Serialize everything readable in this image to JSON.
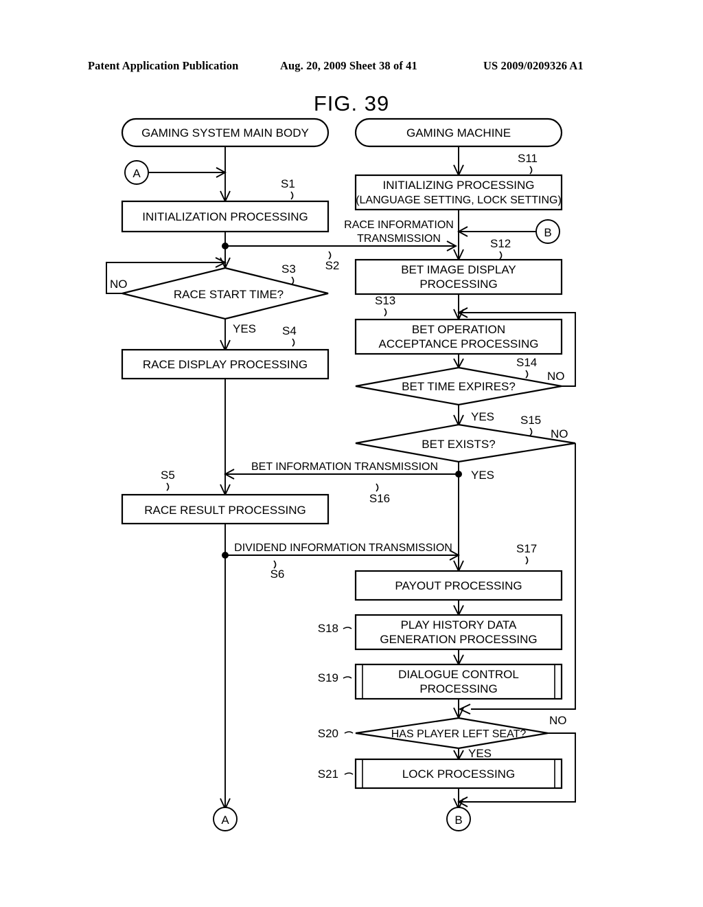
{
  "header": {
    "publication": "Patent Application Publication",
    "date_sheet": "Aug. 20, 2009  Sheet 38 of 41",
    "patent_number": "US 2009/0209326 A1"
  },
  "figure": {
    "title": "FIG. 39"
  },
  "lanes": {
    "left": "GAMING SYSTEM MAIN BODY",
    "right": "GAMING MACHINE"
  },
  "connectors": {
    "a_top": "A",
    "a_bottom": "A",
    "b_top": "B",
    "b_bottom": "B"
  },
  "left_nodes": [
    {
      "step": "S1",
      "text": "INITIALIZATION PROCESSING",
      "shape": "process"
    },
    {
      "step": "S3",
      "text": "RACE START TIME?",
      "shape": "decision"
    },
    {
      "step": "S4",
      "text": "RACE DISPLAY PROCESSING",
      "shape": "process"
    },
    {
      "step": "S5",
      "text": "RACE RESULT PROCESSING",
      "shape": "process"
    }
  ],
  "right_nodes": [
    {
      "step": "S11",
      "line1": "INITIALIZING PROCESSING",
      "line2": "(LANGUAGE SETTING, LOCK SETTING)",
      "shape": "process"
    },
    {
      "step": "S12",
      "line1": "BET IMAGE DISPLAY",
      "line2": "PROCESSING",
      "shape": "process"
    },
    {
      "step": "S13",
      "line1": "BET OPERATION",
      "line2": "ACCEPTANCE PROCESSING",
      "shape": "process"
    },
    {
      "step": "S14",
      "line1": "BET TIME EXPIRES?",
      "shape": "decision"
    },
    {
      "step": "S15",
      "line1": "BET EXISTS?",
      "shape": "decision"
    },
    {
      "step": "S17",
      "line1": "PAYOUT PROCESSING",
      "shape": "process"
    },
    {
      "step": "S18",
      "line1": "PLAY HISTORY DATA",
      "line2": "GENERATION PROCESSING",
      "shape": "process"
    },
    {
      "step": "S19",
      "line1": "DIALOGUE CONTROL",
      "line2": "PROCESSING",
      "shape": "subroutine"
    },
    {
      "step": "S20",
      "line1": "HAS PLAYER LEFT SEAT?",
      "shape": "decision"
    },
    {
      "step": "S21",
      "line1": "LOCK PROCESSING",
      "shape": "subroutine"
    }
  ],
  "transmissions": [
    {
      "step": "S2",
      "line1": "RACE INFORMATION",
      "line2": "TRANSMISSION"
    },
    {
      "step": "S16",
      "line1": "BET INFORMATION TRANSMISSION"
    },
    {
      "step": "S6",
      "line1": "DIVIDEND INFORMATION TRANSMISSION"
    }
  ],
  "branch_labels": {
    "s3_no": "NO",
    "s3_yes": "YES",
    "s14_no": "NO",
    "s14_yes": "YES",
    "s15_no": "NO",
    "s15_yes": "YES",
    "s20_no": "NO",
    "s20_yes": "YES"
  },
  "steps": {
    "s1": "S1",
    "s2": "S2",
    "s3": "S3",
    "s4": "S4",
    "s5": "S5",
    "s6": "S6",
    "s11": "S11",
    "s12": "S12",
    "s13": "S13",
    "s14": "S14",
    "s15": "S15",
    "s16": "S16",
    "s17": "S17",
    "s18": "S18",
    "s19": "S19",
    "s20": "S20",
    "s21": "S21"
  },
  "colors": {
    "ink": "#000000",
    "paper": "#ffffff"
  }
}
